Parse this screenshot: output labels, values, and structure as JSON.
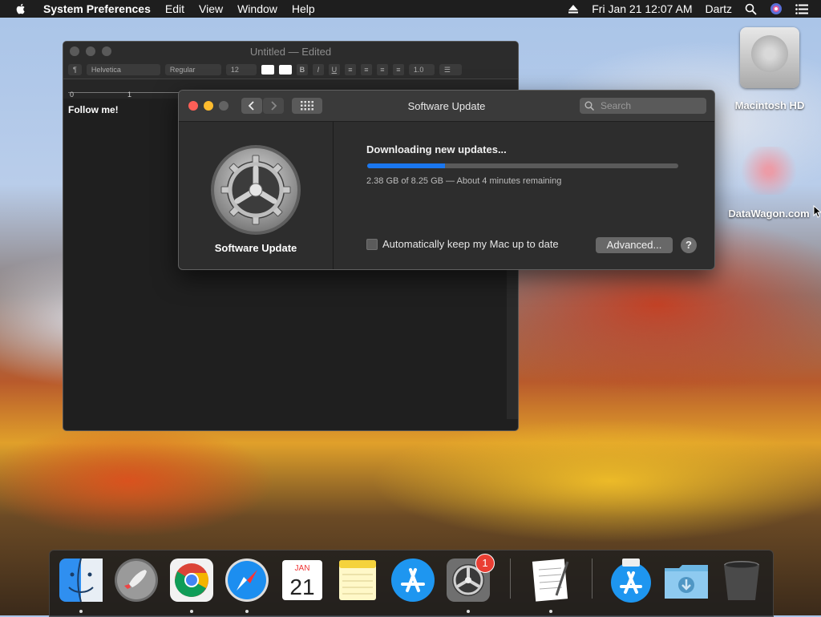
{
  "menubar": {
    "app_name": "System Preferences",
    "menus": [
      "Edit",
      "View",
      "Window",
      "Help"
    ],
    "datetime": "Fri Jan 21  12:07 AM",
    "user": "Dartz"
  },
  "desktop": {
    "icons": [
      {
        "label": "Macintosh HD"
      },
      {
        "label": "DataWagon.com"
      }
    ]
  },
  "textedit": {
    "title": "Untitled — Edited",
    "toolbar": {
      "paragraph": "¶",
      "font": "Helvetica",
      "style": "Regular",
      "size": "12",
      "bold": "B",
      "italic": "I",
      "underline": "U",
      "spacing": "1.0"
    },
    "ruler": {
      "mark0": "0",
      "mark1": "1"
    },
    "body": "Follow me!"
  },
  "software_update": {
    "window_title": "Software Update",
    "search_placeholder": "Search",
    "pane_label": "Software Update",
    "status": "Downloading new updates...",
    "progress": 0.25,
    "detail": "2.38 GB of 8.25 GB — About 4 minutes remaining",
    "auto_update_label": "Automatically keep my Mac up to date",
    "auto_update_checked": false,
    "advanced_button": "Advanced...",
    "help_button": "?"
  },
  "dock": {
    "apps": [
      {
        "name": "Finder",
        "icon": "finder-icon",
        "running": true
      },
      {
        "name": "Launchpad",
        "icon": "rocket-icon",
        "running": false
      },
      {
        "name": "Google Chrome",
        "icon": "chrome-icon",
        "running": true
      },
      {
        "name": "Safari",
        "icon": "compass-icon",
        "running": true
      },
      {
        "name": "Calendar",
        "icon": "calendar-icon",
        "running": false
      },
      {
        "name": "Notes",
        "icon": "notes-icon",
        "running": false
      },
      {
        "name": "App Store",
        "icon": "app-store-icon",
        "running": false
      },
      {
        "name": "System Preferences",
        "icon": "gear-icon",
        "running": true
      },
      {
        "name": "TextEdit",
        "icon": "textedit-icon",
        "running": true
      },
      {
        "name": "App Store Installer",
        "icon": "app-store-icon",
        "running": false
      },
      {
        "name": "Downloads",
        "icon": "downloads-folder-icon",
        "running": false
      },
      {
        "name": "Trash",
        "icon": "trash-icon",
        "running": false
      }
    ],
    "calendar_month": "JAN",
    "calendar_day": "21",
    "sysprefs_badge": "1"
  },
  "colors": {
    "close": "#fd5f57",
    "minimize": "#febc2e",
    "zoom_disabled": "#636363",
    "progress_fill": "#1a77ef",
    "badge": "#ea3e33"
  }
}
